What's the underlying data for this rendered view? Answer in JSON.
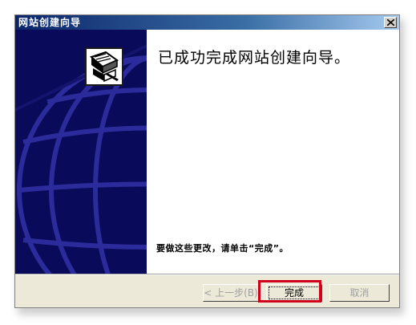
{
  "window": {
    "title": "网站创建向导"
  },
  "content": {
    "heading": "已成功完成网站创建向导。",
    "instruction": "要做这些更改，请单击“完成”。"
  },
  "buttons": {
    "back": "< 上一步(B)",
    "finish": "完成",
    "cancel": "取消"
  },
  "icons": {
    "close": "close-icon",
    "wizard": "website-wizard-icon",
    "banner": "globe-graphic"
  },
  "colors": {
    "titlebar_start": "#0a246a",
    "banner_bg": "#0a0a5a",
    "highlight": "#d0021b"
  }
}
